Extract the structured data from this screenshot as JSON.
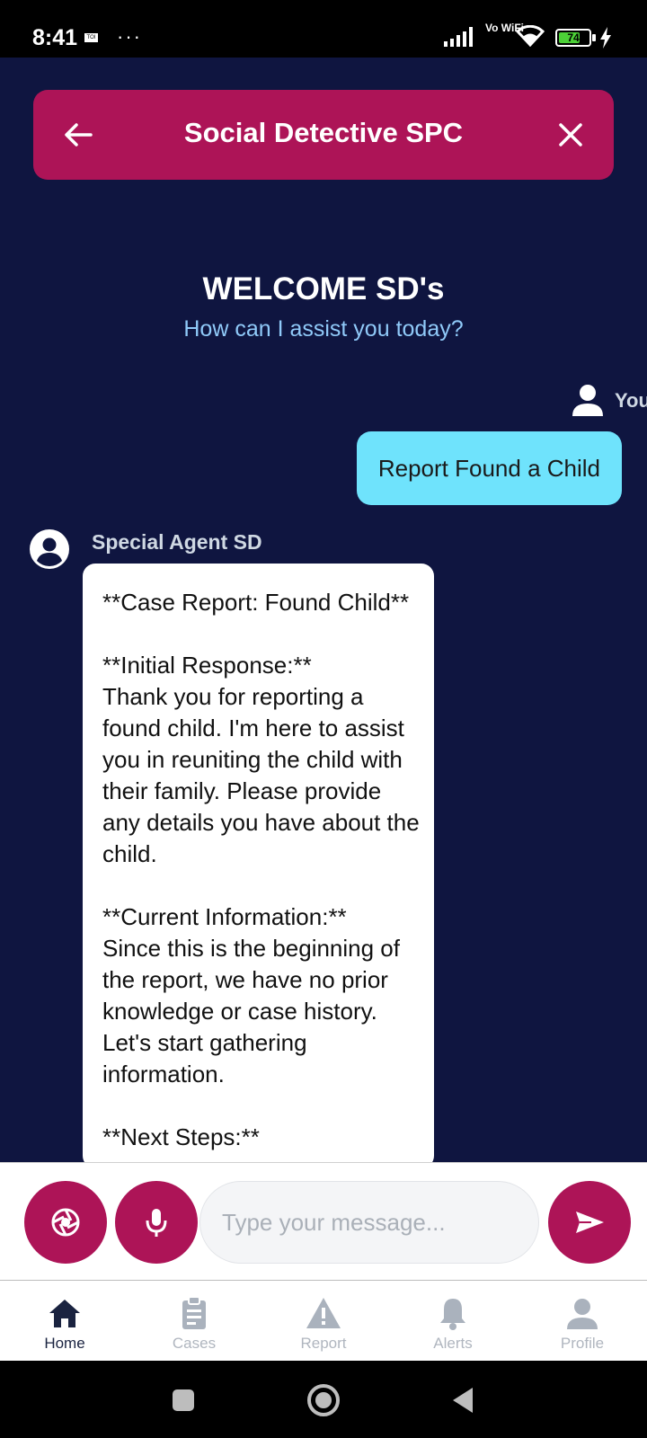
{
  "status_bar": {
    "time": "8:41",
    "news_badge": "TOI",
    "more": "···",
    "network": "Vo WiFi",
    "battery": "74",
    "battery_level": 0.74
  },
  "header": {
    "title": "Social Detective SPC",
    "back_icon": "arrow-left-icon",
    "close_icon": "close-icon",
    "color": "#ad1457"
  },
  "welcome": {
    "heading": "WELCOME SD's",
    "subtitle": "How can I assist you today?"
  },
  "chat": {
    "user_label": "You",
    "user_message": "Report Found a Child",
    "agent_label": "Special Agent SD",
    "agent_message": "**Case Report: Found Child**\n\n**Initial Response:**\nThank you for reporting a found child. I'm here to assist you in reuniting the child with their family. Please provide any details you have about the child.\n\n**Current Information:**\nSince this is the beginning of the report, we have no prior knowledge or case history. Let's start gathering information.\n\n**Next Steps:**"
  },
  "composer": {
    "placeholder": "Type your message...",
    "value": "",
    "camera_icon": "camera-aperture-icon",
    "mic_icon": "microphone-icon",
    "send_icon": "send-icon"
  },
  "tabs": [
    {
      "label": "Home",
      "icon": "home-icon",
      "active": true
    },
    {
      "label": "Cases",
      "icon": "clipboard-icon",
      "active": false
    },
    {
      "label": "Report",
      "icon": "warning-icon",
      "active": false
    },
    {
      "label": "Alerts",
      "icon": "bell-icon",
      "active": false
    },
    {
      "label": "Profile",
      "icon": "user-icon",
      "active": false
    }
  ],
  "colors": {
    "background": "#0f1540",
    "accent": "#ad1457",
    "user_bubble": "#6fe3fc",
    "subtitle": "#90caf9"
  }
}
